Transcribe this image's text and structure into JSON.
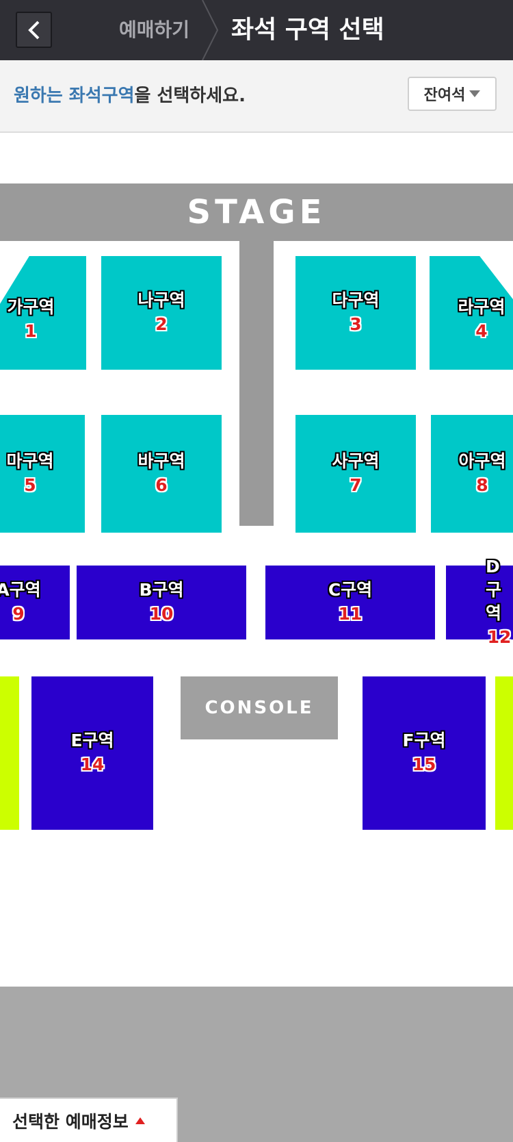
{
  "header": {
    "prev_step": "예매하기",
    "title": "좌석 구역 선택"
  },
  "infobar": {
    "instruction_highlight": "원하는 좌석구역",
    "instruction_rest": "을 선택하세요.",
    "remaining_seats_label": "잔여석"
  },
  "map": {
    "stage_label": "STAGE",
    "console_label": "CONSOLE",
    "zones": [
      {
        "name": "가구역",
        "number": "1"
      },
      {
        "name": "나구역",
        "number": "2"
      },
      {
        "name": "다구역",
        "number": "3"
      },
      {
        "name": "라구역",
        "number": "4"
      },
      {
        "name": "마구역",
        "number": "5"
      },
      {
        "name": "바구역",
        "number": "6"
      },
      {
        "name": "사구역",
        "number": "7"
      },
      {
        "name": "아구역",
        "number": "8"
      },
      {
        "name": "A구역",
        "number": "9"
      },
      {
        "name": "B구역",
        "number": "10"
      },
      {
        "name": "C구역",
        "number": "11"
      },
      {
        "name": "D구역",
        "number": "12"
      },
      {
        "name": "E구역",
        "number": "14"
      },
      {
        "name": "F구역",
        "number": "15"
      }
    ],
    "colors": {
      "floor_zone": "#00c8c8",
      "seat_zone": "#2a00cc",
      "side_zone": "#ccff00",
      "stage": "#9a9a9a"
    }
  },
  "footer": {
    "booking_info_label": "선택한 예매정보"
  }
}
